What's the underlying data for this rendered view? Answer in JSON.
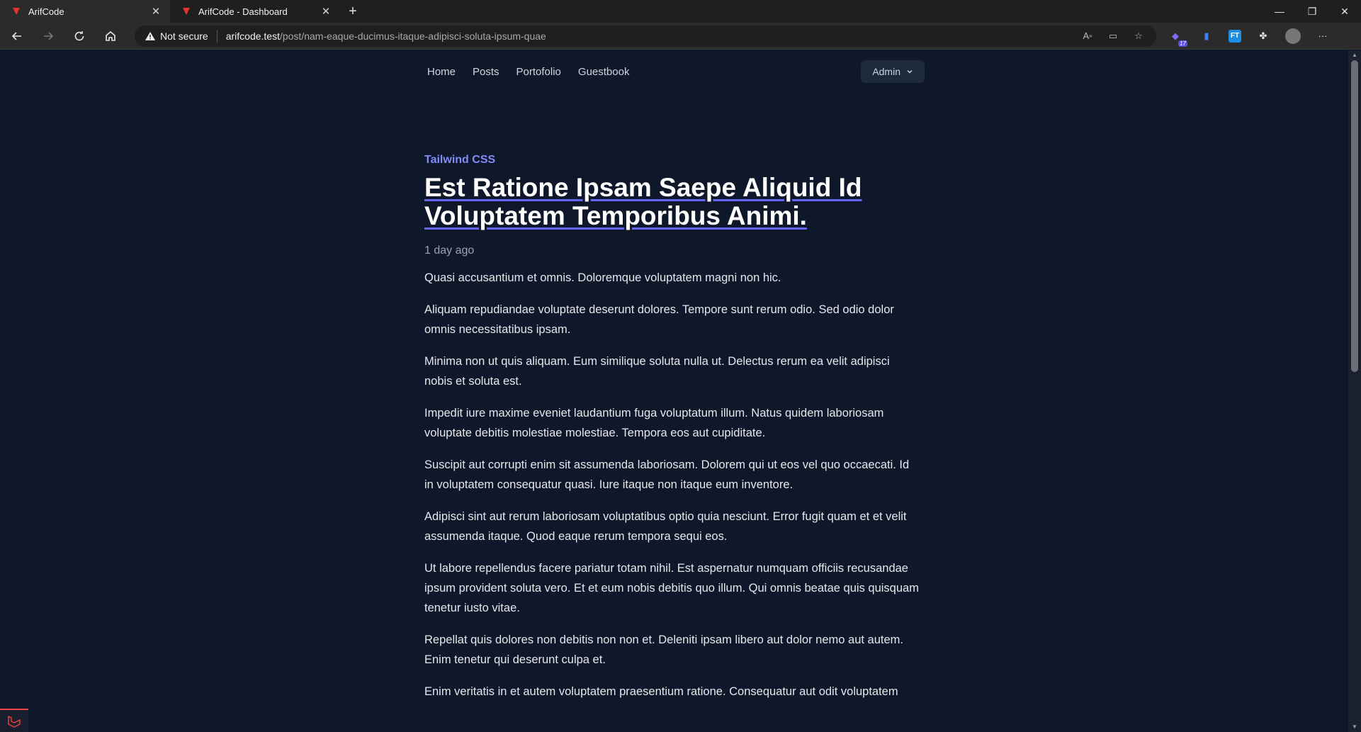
{
  "browser": {
    "tabs": [
      {
        "title": "ArifCode",
        "active": true
      },
      {
        "title": "ArifCode - Dashboard",
        "active": false
      }
    ],
    "new_tab": "+",
    "security_label": "Not secure",
    "url_host": "arifcode.test",
    "url_path": "/post/nam-eaque-ducimus-itaque-adipisci-soluta-ipsum-quae",
    "extension_badge": "17"
  },
  "nav": {
    "items": [
      "Home",
      "Posts",
      "Portofolio",
      "Guestbook"
    ],
    "admin_label": "Admin"
  },
  "post": {
    "category": "Tailwind CSS",
    "title": "Est Ratione Ipsam Saepe Aliquid Id Voluptatem Temporibus Animi.",
    "time": "1 day ago",
    "paragraphs": [
      "Quasi accusantium et omnis. Doloremque voluptatem magni non hic.",
      "Aliquam repudiandae voluptate deserunt dolores. Tempore sunt rerum odio. Sed odio dolor omnis necessitatibus ipsam.",
      "Minima non ut quis aliquam. Eum similique soluta nulla ut. Delectus rerum ea velit adipisci nobis et soluta est.",
      "Impedit iure maxime eveniet laudantium fuga voluptatum illum. Natus quidem laboriosam voluptate debitis molestiae molestiae. Tempora eos aut cupiditate.",
      "Suscipit aut corrupti enim sit assumenda laboriosam. Dolorem qui ut eos vel quo occaecati. Id in voluptatem consequatur quasi. Iure itaque non itaque eum inventore.",
      "Adipisci sint aut rerum laboriosam voluptatibus optio quia nesciunt. Error fugit quam et et velit assumenda itaque. Quod eaque rerum tempora sequi eos.",
      "Ut labore repellendus facere pariatur totam nihil. Est aspernatur numquam officiis recusandae ipsum provident soluta vero. Et et eum nobis debitis quo illum. Qui omnis beatae quis quisquam tenetur iusto vitae.",
      "Repellat quis dolores non debitis non non et. Deleniti ipsam libero aut dolor nemo aut autem. Enim tenetur qui deserunt culpa et.",
      "Enim veritatis in et autem voluptatem praesentium ratione. Consequatur aut odit voluptatem"
    ]
  },
  "colors": {
    "page_bg": "#0f172a",
    "accent": "#818cf8",
    "underline": "#6366f1",
    "favicon": "#e3342f"
  }
}
